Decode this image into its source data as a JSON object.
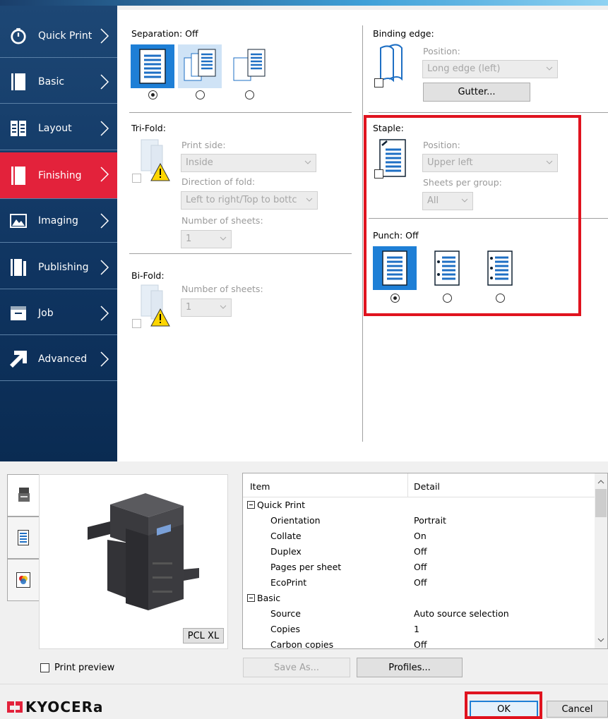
{
  "sidebar": {
    "items": [
      {
        "label": "Quick Print",
        "icon": "stopwatch-icon"
      },
      {
        "label": "Basic",
        "icon": "page-icon"
      },
      {
        "label": "Layout",
        "icon": "layout-icon"
      },
      {
        "label": "Finishing",
        "icon": "finishing-icon"
      },
      {
        "label": "Imaging",
        "icon": "imaging-icon"
      },
      {
        "label": "Publishing",
        "icon": "publishing-icon"
      },
      {
        "label": "Job",
        "icon": "job-icon"
      },
      {
        "label": "Advanced",
        "icon": "arrow-icon"
      }
    ],
    "active": "Finishing"
  },
  "finishing": {
    "separation_label": "Separation:",
    "separation_value": "Off",
    "trifold": {
      "title": "Tri-Fold:",
      "print_side_label": "Print side:",
      "print_side_value": "Inside",
      "direction_label": "Direction of fold:",
      "direction_value": "Left to right/Top to bottc",
      "sheets_label": "Number of sheets:",
      "sheets_value": "1"
    },
    "bifold": {
      "title": "Bi-Fold:",
      "sheets_label": "Number of sheets:",
      "sheets_value": "1"
    },
    "binding": {
      "title": "Binding edge:",
      "position_label": "Position:",
      "position_value": "Long edge (left)",
      "gutter_button": "Gutter..."
    },
    "staple": {
      "title": "Staple:",
      "position_label": "Position:",
      "position_value": "Upper left",
      "sheets_label": "Sheets per group:",
      "sheets_value": "All"
    },
    "punch": {
      "title": "Punch:",
      "value": "Off"
    }
  },
  "summary": {
    "col_item": "Item",
    "col_detail": "Detail",
    "rows": [
      {
        "item": "Quick Print",
        "detail": "",
        "group": true
      },
      {
        "item": "Orientation",
        "detail": "Portrait",
        "group": false
      },
      {
        "item": "Collate",
        "detail": "On",
        "group": false
      },
      {
        "item": "Duplex",
        "detail": "Off",
        "group": false
      },
      {
        "item": "Pages per sheet",
        "detail": "Off",
        "group": false
      },
      {
        "item": "EcoPrint",
        "detail": "Off",
        "group": false
      },
      {
        "item": "Basic",
        "detail": "",
        "group": true
      },
      {
        "item": "Source",
        "detail": "Auto source selection",
        "group": false
      },
      {
        "item": "Copies",
        "detail": "1",
        "group": false
      },
      {
        "item": "Carbon copies",
        "detail": "Off",
        "group": false
      }
    ]
  },
  "preview": {
    "pcl_label": "PCL XL",
    "print_preview_label": "Print preview"
  },
  "buttons": {
    "save_as": "Save As...",
    "profiles": "Profiles...",
    "ok": "OK",
    "cancel": "Cancel"
  },
  "brand": {
    "name": "KYOCERa",
    "accent": "#e3223b",
    "highlight": "#e0131f"
  }
}
